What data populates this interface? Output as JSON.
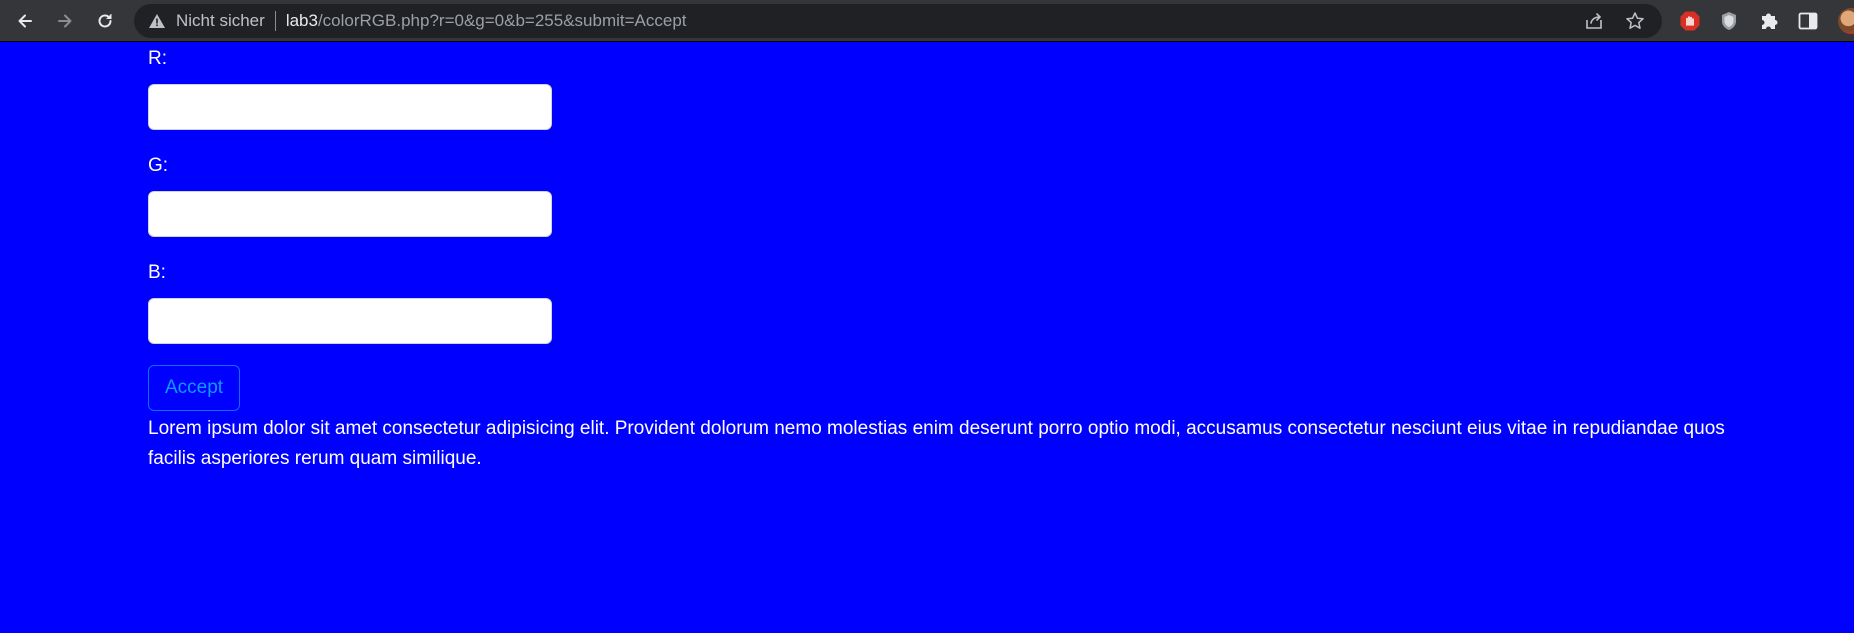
{
  "browser": {
    "nav": {
      "back_icon": "arrow-left-icon",
      "forward_icon": "arrow-right-icon",
      "reload_icon": "reload-icon"
    },
    "omnibox": {
      "security_icon": "warning-triangle-icon",
      "security_label": "Nicht sicher",
      "url_host": "lab3",
      "url_path": "/colorRGB.php?r=0&g=0&b=255&submit=Accept",
      "share_icon": "share-icon",
      "bookmark_icon": "star-icon"
    },
    "extensions": [
      "stop-hand-extension-icon",
      "shield-extension-icon",
      "puzzle-extensions-icon",
      "side-panel-icon"
    ],
    "profile_icon": "profile-avatar"
  },
  "page": {
    "background_color": "#0000fe",
    "form": {
      "r_label": "R:",
      "r_value": "",
      "g_label": "G:",
      "g_value": "",
      "b_label": "B:",
      "b_value": "",
      "submit_label": "Accept"
    },
    "paragraph": "Lorem ipsum dolor sit amet consectetur adipisicing elit. Provident dolorum nemo molestias enim deserunt porro optio modi, accusamus consectetur nesciunt eius vitae in repudiandae quos facilis asperiores rerum quam similique."
  }
}
